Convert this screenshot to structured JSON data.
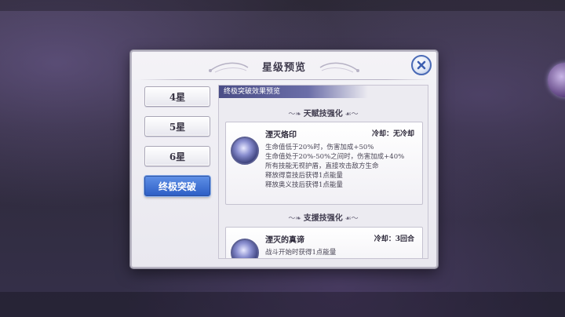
{
  "dialog": {
    "title": "星级预览",
    "close_icon": "close-icon"
  },
  "tabs": [
    {
      "label": "4星",
      "active": false
    },
    {
      "label": "5星",
      "active": false
    },
    {
      "label": "6星",
      "active": false
    },
    {
      "label": "终极突破",
      "active": true
    }
  ],
  "panel": {
    "header": "终极突破效果预览",
    "sections": [
      {
        "title": "天赋技强化",
        "card": {
          "name": "湮灭烙印",
          "cooldown": "冷却：无冷却",
          "icon": "skill-emblem-icon",
          "lines": [
            "生命值低于20%时，伤害加成+50%",
            "生命值处于20%-50%之间时，伤害加成+40%",
            "所有技能无视护盾，直接攻击敌方生命",
            "释放得意技后获得1点能量",
            "释放奥义技后获得1点能量"
          ]
        }
      },
      {
        "title": "支援技强化",
        "card": {
          "name": "湮灭的真谛",
          "cooldown": "冷却：3回合",
          "icon": "skill-emblem-icon",
          "lines": [
            "战斗开始时获得1点能量"
          ]
        }
      }
    ]
  },
  "colors": {
    "accent_blue": "#2e5fc6",
    "panel_header": "#4a4d86"
  }
}
